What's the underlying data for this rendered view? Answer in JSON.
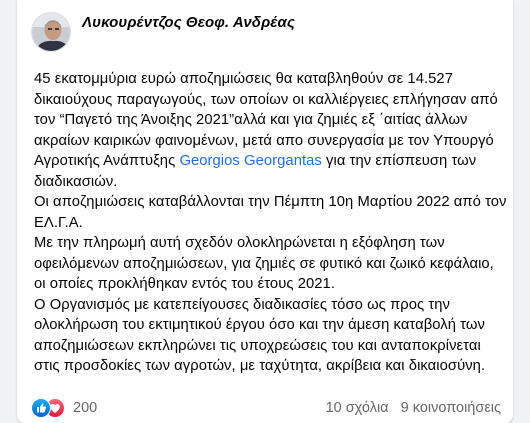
{
  "post": {
    "author": "Λυκουρέντζος Θεοφ. Ανδρέας",
    "body": {
      "para1_before": "45 εκατομμύρια ευρώ αποζημιώσεις θα καταβληθούν σε 14.527 δικαιούχους παραγωγούς, των οποίων οι καλλιέργειες επλήγησαν από τον “Παγετό της Άνοιξης 2021”αλλά και για ζημιές εξ ΄αιτίας άλλων ακραίων καιρικών φαινομένων, μετά απο συνεργασία με τον Υπουργό Αγροτικής Ανάπτυξης",
      "mention": "Georgios Georgantas",
      "para1_after": "για την επίσπευση των διαδικασιών.",
      "para2": "Οι αποζημιώσεις καταβάλλονται την Πέμπτη 10η Μαρτίου 2022 από τον ΕΛ.Γ.Α.",
      "para3": "Με την πληρωμή αυτή σχεδόν ολοκληρώνεται η εξόφληση των οφειλόμενων αποζημιώσεων, για ζημιές σε φυτικό και ζωικό κεφάλαιο, οι οποίες προκλήθηκαν εντός του έτους 2021.",
      "para4": "Ο Οργανισμός με κατεπείγουσες διαδικασίες τόσο ως προς την ολοκλήρωση του εκτιμητικού έργου όσο και την άμεση καταβολή των αποζημιώσεων εκπληρώνει τις υποχρεώσεις του και ανταποκρίνεται στις προσδοκίες των αγροτών, με ταχύτητα, ακρίβεια και δικαιοσύνη."
    }
  },
  "footer": {
    "reaction_icons": [
      "like-icon",
      "love-icon"
    ],
    "reaction_count": "200",
    "comments": "10 σχόλια",
    "shares": "9 κοινοποιήσεις"
  },
  "colors": {
    "mention": "#216fdb",
    "like": "#1877f2",
    "love": "#f33e58",
    "muted_text": "#65676b"
  }
}
